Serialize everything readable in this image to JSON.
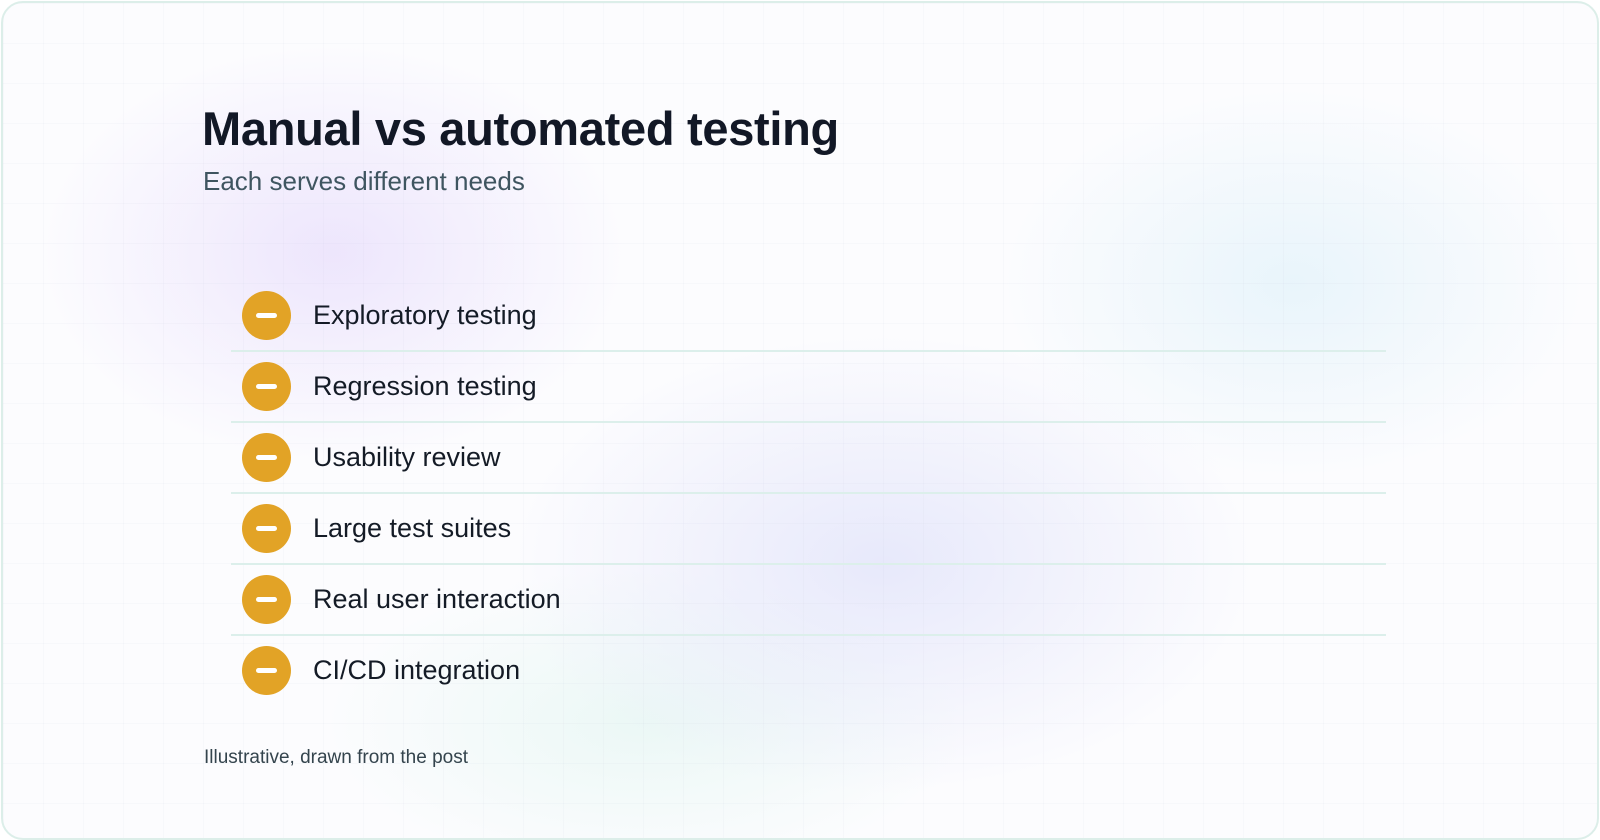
{
  "header": {
    "title": "Manual vs automated testing",
    "subtitle": "Each serves different needs"
  },
  "list": {
    "items": [
      {
        "label": "Exploratory testing",
        "icon": "minus-circle-icon"
      },
      {
        "label": "Regression testing",
        "icon": "minus-circle-icon"
      },
      {
        "label": "Usability review",
        "icon": "minus-circle-icon"
      },
      {
        "label": "Large test suites",
        "icon": "minus-circle-icon"
      },
      {
        "label": "Real user interaction",
        "icon": "minus-circle-icon"
      },
      {
        "label": "CI/CD integration",
        "icon": "minus-circle-icon"
      }
    ]
  },
  "footer": {
    "note": "Illustrative, drawn from the post"
  },
  "colors": {
    "accent": "#e2a326",
    "title": "#121826",
    "subtitle": "#3f5560",
    "divider": "#dcefeb",
    "border": "#dceee9"
  }
}
